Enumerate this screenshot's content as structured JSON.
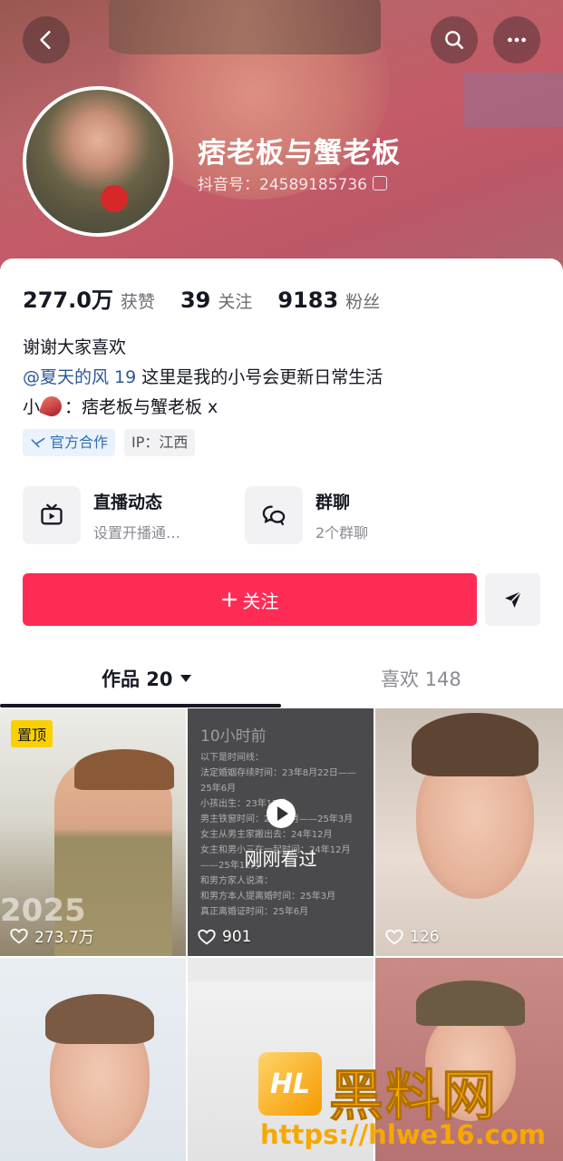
{
  "header": {
    "nickname": "痞老板与蟹老板",
    "douyin_id": "抖音号：24589185736"
  },
  "stats": [
    {
      "value": "277.0万",
      "label": "获赞"
    },
    {
      "value": "39",
      "label": "关注"
    },
    {
      "value": "9183",
      "label": "粉丝"
    }
  ],
  "bio": {
    "line1": "谢谢大家喜欢",
    "mention": "@夏天的风 19",
    "line2_rest": " 这里是我的小号会更新日常生活",
    "line3_prefix": "小",
    "line3_rest": "：痞老板与蟹老板 x"
  },
  "tags": {
    "official": "官方合作",
    "ip": "IP：江西"
  },
  "tiles": [
    {
      "title": "直播动态",
      "subtitle": "设置开播通…",
      "icon": "tv-icon"
    },
    {
      "title": "群聊",
      "subtitle": "2个群聊",
      "icon": "chat-bubbles-icon"
    }
  ],
  "actions": {
    "follow_label": "关注"
  },
  "tabs": {
    "works_label": "作品 20",
    "likes_label": "喜欢 148"
  },
  "videos": [
    {
      "likes": "273.7万",
      "pinned_label": "置顶",
      "year": "2025"
    },
    {
      "likes": "901",
      "ago": "10小时前",
      "watched_label": "刚刚看过"
    },
    {
      "likes": "126"
    },
    {
      "likes": ""
    },
    {
      "likes": ""
    },
    {
      "likes": ""
    }
  ],
  "video2_text": "以下是时间线：\n法定婚姻存续时间：23年8月22日——25年6月\n小孩出生：23年12月\n男主铁窗时间：24年1月——25年3月\n女主从男主家搬出去：24年12月\n女主和男小三在一起时间：24年12月——25年12月\n和男方家人说清：\n和男方本人提离婚时间：25年3月\n真正离婚证时间：25年6月",
  "watermark": {
    "logo_text": "HL",
    "title": "黑料网",
    "url": "https://hlwe16.com"
  },
  "colors": {
    "accent": "#fe2c55",
    "mention": "#2b5797",
    "pin": "#fad000"
  }
}
